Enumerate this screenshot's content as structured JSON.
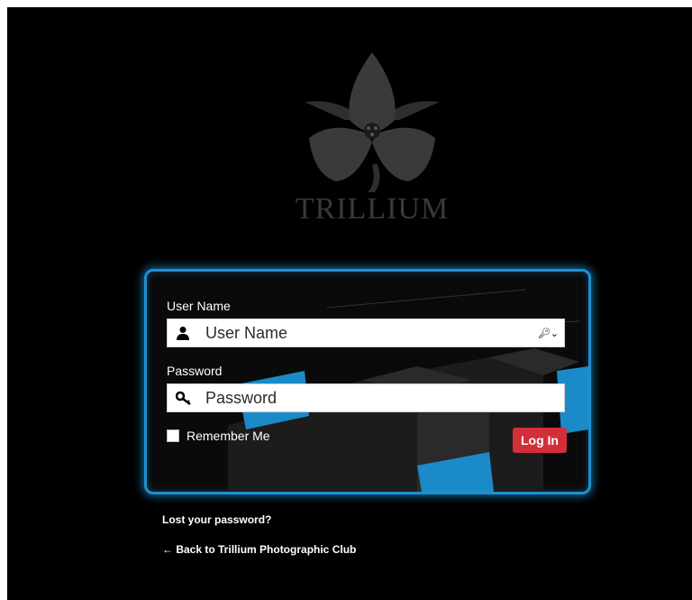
{
  "brand": {
    "name": "TRILLIUM"
  },
  "login_form": {
    "username": {
      "label": "User Name",
      "placeholder": "User Name",
      "value": ""
    },
    "password": {
      "label": "Password",
      "placeholder": "Password",
      "value": ""
    },
    "remember_me": {
      "label": "Remember Me",
      "checked": false
    },
    "submit_label": "Log In"
  },
  "links": {
    "lost_password": "Lost your password?",
    "back_to_site": "← Back to Trillium Photographic Club"
  },
  "colors": {
    "background": "#000000",
    "panel_border": "#1f8fd1",
    "submit_button": "#d32f3a",
    "logo": "#3a3a3a"
  },
  "icons": {
    "username_field": "user-icon",
    "password_field": "key-icon",
    "autofill_menu": "key-dropdown-icon"
  }
}
